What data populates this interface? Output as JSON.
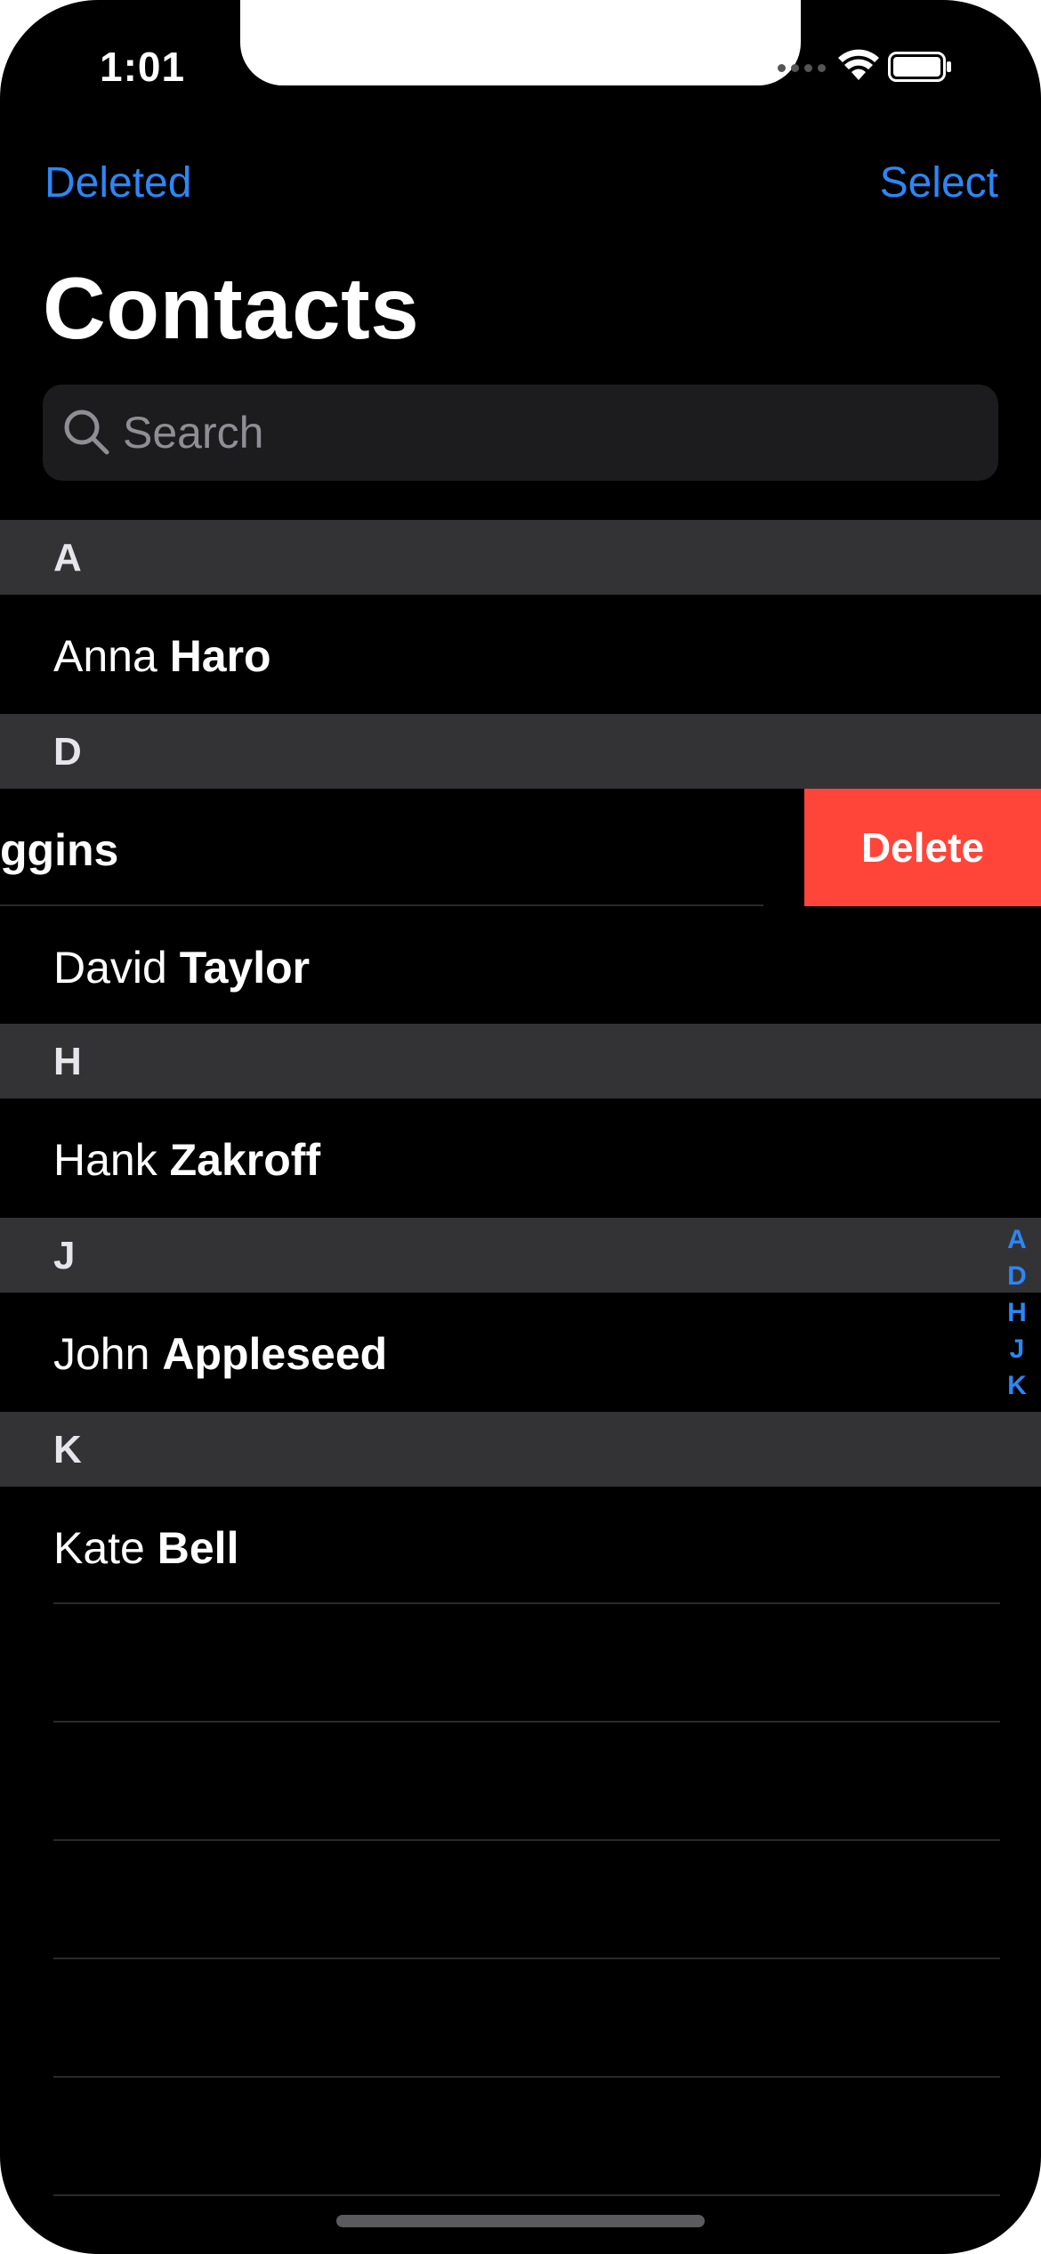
{
  "status_bar": {
    "time": "1:01"
  },
  "nav": {
    "left_label": "Deleted",
    "right_label": "Select",
    "title": "Contacts"
  },
  "search": {
    "placeholder": "Search"
  },
  "sections": [
    {
      "letter": "A",
      "contacts": [
        {
          "first": "Anna",
          "last": "Haro"
        }
      ]
    },
    {
      "letter": "D",
      "contacts": [
        {
          "swiped_text": "ggins",
          "delete_label": "Delete"
        },
        {
          "first": "David",
          "last": "Taylor"
        }
      ]
    },
    {
      "letter": "H",
      "contacts": [
        {
          "first": "Hank",
          "last": "Zakroff"
        }
      ]
    },
    {
      "letter": "J",
      "contacts": [
        {
          "first": "John",
          "last": "Appleseed"
        }
      ]
    },
    {
      "letter": "K",
      "contacts": [
        {
          "first": "Kate",
          "last": "Bell"
        }
      ]
    }
  ],
  "index_letters": [
    "A",
    "D",
    "H",
    "J",
    "K"
  ],
  "colors": {
    "accent": "#2d86f6",
    "destructive": "#ff453a",
    "section_bg": "#333336"
  }
}
